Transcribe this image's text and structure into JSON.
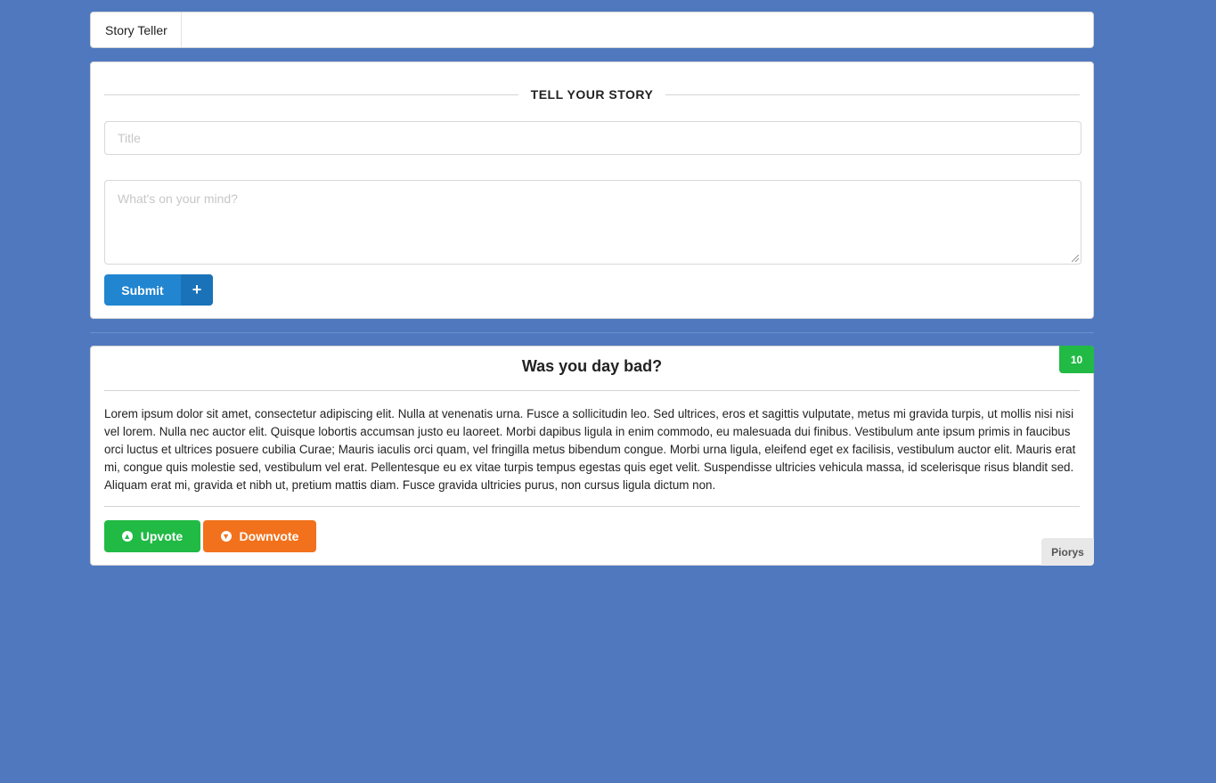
{
  "menu": {
    "brand": "Story Teller"
  },
  "form": {
    "heading": "TELL YOUR STORY",
    "title_placeholder": "Title",
    "title_value": "",
    "body_placeholder": "What's on your mind?",
    "body_value": "",
    "submit_label": "Submit",
    "submit_icon": "plus-icon"
  },
  "stories": [
    {
      "title": "Was you day bad?",
      "votes": "10",
      "body": "Lorem ipsum dolor sit amet, consectetur adipiscing elit. Nulla at venenatis urna. Fusce a sollicitudin leo. Sed ultrices, eros et sagittis vulputate, metus mi gravida turpis, ut mollis nisi nisi vel lorem. Nulla nec auctor elit. Quisque lobortis accumsan justo eu laoreet. Morbi dapibus ligula in enim commodo, eu malesuada dui finibus. Vestibulum ante ipsum primis in faucibus orci luctus et ultrices posuere cubilia Curae; Mauris iaculis orci quam, vel fringilla metus bibendum congue. Morbi urna ligula, eleifend eget ex facilisis, vestibulum auctor elit. Mauris erat mi, congue quis molestie sed, vestibulum vel erat. Pellentesque eu ex vitae turpis tempus egestas quis eget velit. Suspendisse ultricies vehicula massa, id scelerisque risus blandit sed. Aliquam erat mi, gravida et nibh ut, pretium mattis diam. Fusce gravida ultricies purus, non cursus ligula dictum non.",
      "upvote_label": "Upvote",
      "downvote_label": "Downvote",
      "author": "Piorys"
    }
  ],
  "colors": {
    "background": "#4f78be",
    "primary": "#2185d0",
    "green": "#21ba45",
    "orange": "#f2711c"
  }
}
